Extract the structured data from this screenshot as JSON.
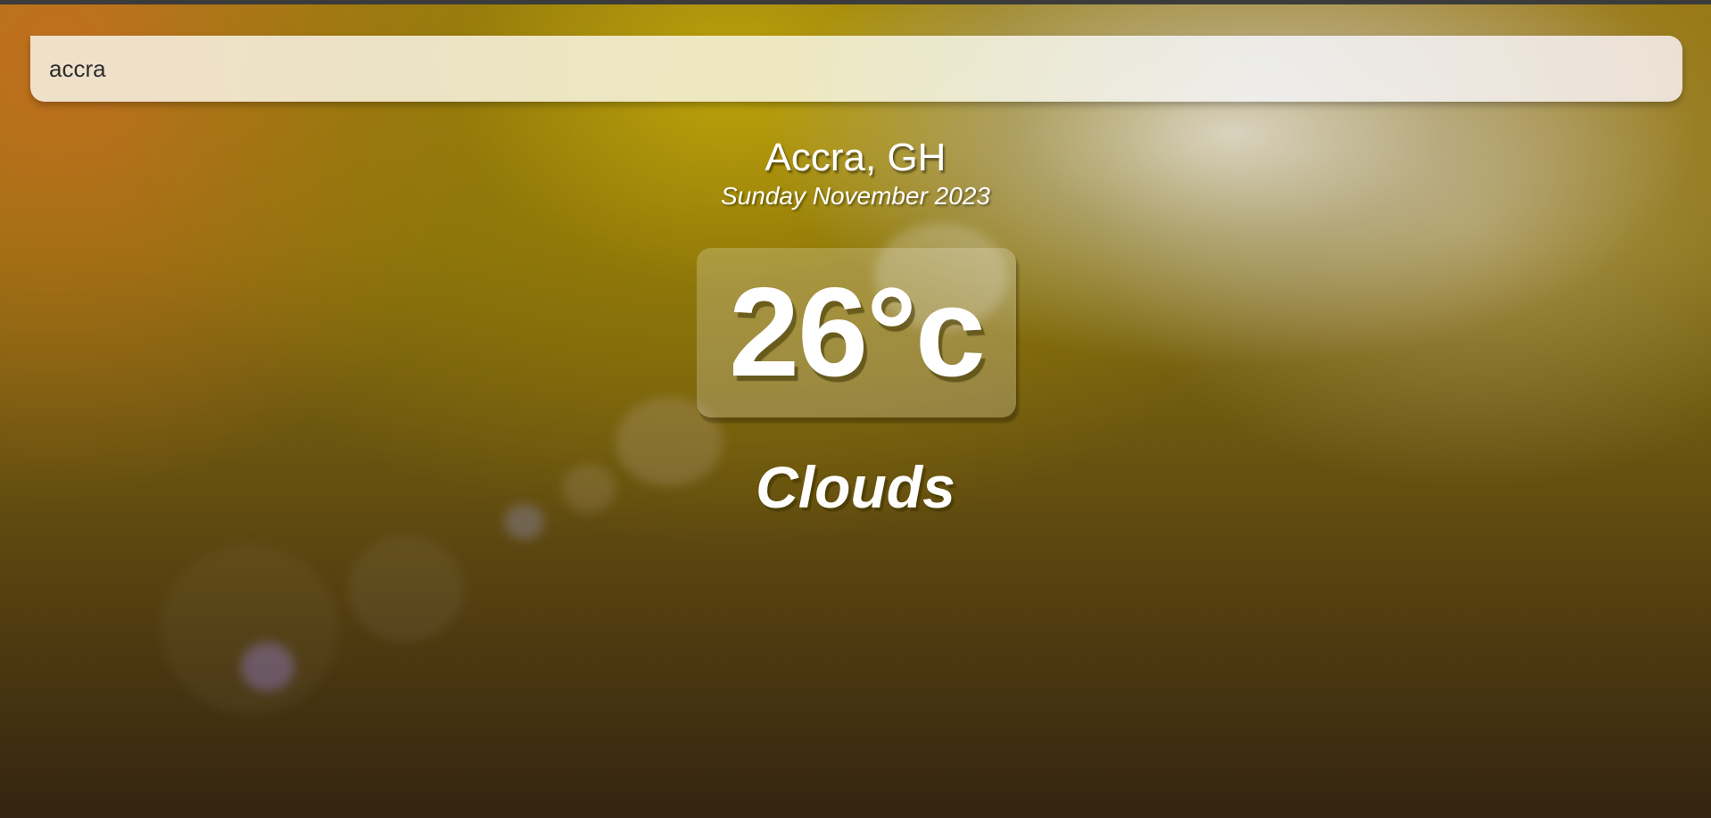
{
  "search": {
    "value": "accra"
  },
  "location": {
    "name": "Accra, GH",
    "date": "Sunday November 2023"
  },
  "weather": {
    "temperature": "26°c",
    "condition": "Clouds"
  },
  "colors": {
    "text": "#ffffff",
    "search_text": "#2d2d2d",
    "top_bar": "#3b3b3b"
  }
}
